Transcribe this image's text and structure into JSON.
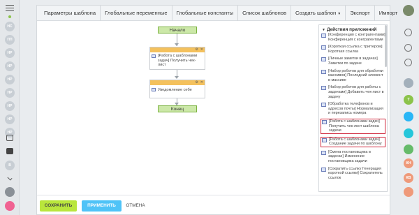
{
  "tabs": [
    {
      "label": "Параметры шаблона"
    },
    {
      "label": "Глобальные переменные"
    },
    {
      "label": "Глобальные константы"
    },
    {
      "label": "Список шаблонов"
    },
    {
      "label": "Создать шаблон",
      "has_dropdown": true
    },
    {
      "label": "Экспорт"
    },
    {
      "label": "Импорт"
    }
  ],
  "left_rail": [
    {
      "text": "НС"
    },
    {
      "text": "ПП"
    },
    {
      "text": "НР"
    },
    {
      "text": "НР"
    },
    {
      "text": "НР"
    },
    {
      "text": "НР"
    },
    {
      "text": "НР"
    },
    {
      "text": "НР"
    },
    {
      "text": "НР"
    },
    {
      "text": "В"
    }
  ],
  "workflow": {
    "start_label": "Начало",
    "end_label": "Конец",
    "actions": [
      {
        "text": "[Работа с шаблонами задач] Получить чек-лист"
      },
      {
        "text": "Уведомление себе"
      }
    ]
  },
  "panel": {
    "title": "Действия приложений",
    "items": [
      {
        "text": "[Конференция с контрагентами] Конференция с контрагентами",
        "highlighted": false
      },
      {
        "text": "[Короткая ссылка с триггером] Короткая ссылка",
        "highlighted": false
      },
      {
        "text": "[Личные заметки в задачах] Заметки по задаче",
        "highlighted": false
      },
      {
        "text": "[Набор роботов для обработки массивов] Последний элемент в массиве",
        "highlighted": false
      },
      {
        "text": "[Набор роботов для работы с задачами] Добавить чек-лист в задачу",
        "highlighted": false
      },
      {
        "text": "[Обработка телефонов и адресов почты] Нормализация и перезапись номера",
        "highlighted": false
      },
      {
        "text": "[Работа с шаблонами задач] Получить чек-лист шаблона задачи",
        "highlighted": true
      },
      {
        "text": "[Работа с шаблонами задач] Создание задачи по шаблону",
        "highlighted": true
      },
      {
        "text": "[Смена постановщика в задачах] Изменение постановщика задачи",
        "highlighted": false
      },
      {
        "text": "[Сократить ссылку Генерация короткой ссылки] Сократитель ссылок",
        "highlighted": false
      }
    ]
  },
  "bottom": {
    "save_label": "СОХРАНИТЬ",
    "apply_label": "ПРИМЕНИТЬ",
    "cancel_label": "ОТМЕНА"
  },
  "right_rail": [
    {
      "text": "T",
      "color": "#8bc34a"
    },
    {
      "text": "",
      "color": "#29b6f6"
    },
    {
      "text": "",
      "color": "#26c6da"
    },
    {
      "text": "",
      "color": "#66bb6a"
    },
    {
      "text": "КН",
      "color": "#ef9a7a"
    },
    {
      "text": "КВ",
      "color": "#ef9a7a"
    },
    {
      "text": "",
      "color": "#ef9a7a"
    }
  ],
  "colors": {
    "start_end_fill": "#cce8a8",
    "action_header": "#f4c15d",
    "save_button": "#b9e63c",
    "apply_button": "#4fc3f7",
    "highlight_border": "#d0263b"
  }
}
